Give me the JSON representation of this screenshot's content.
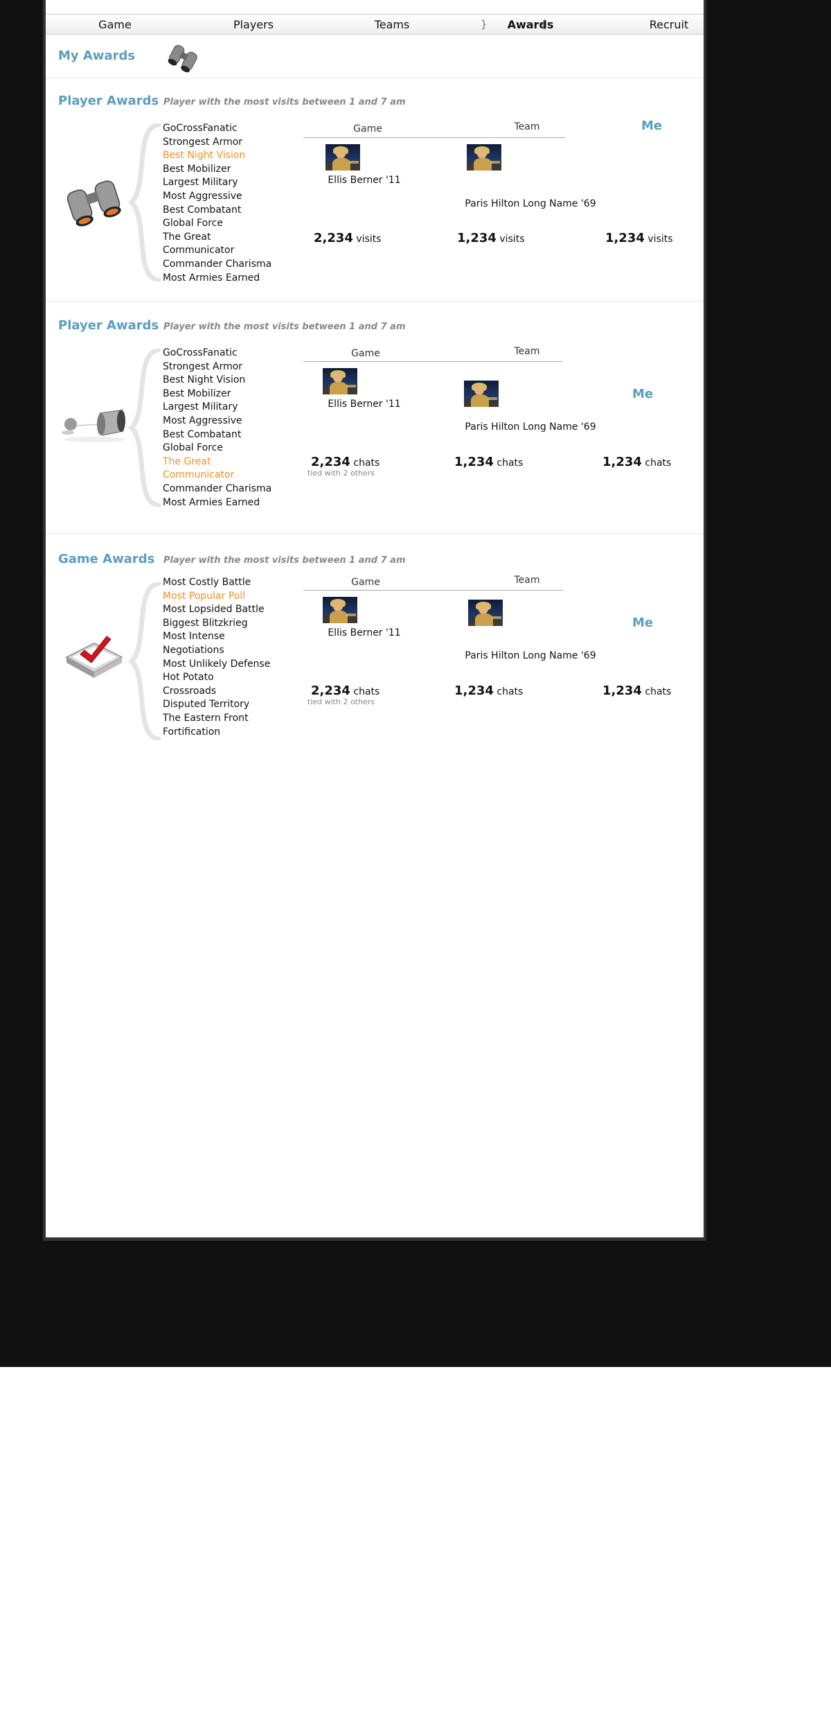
{
  "nav": {
    "items": [
      "Game",
      "Players",
      "Teams",
      "Awards",
      "Recruit"
    ],
    "active_index": 3
  },
  "my_awards": {
    "title": "My Awards",
    "icon": "binoculars-icon"
  },
  "sections": [
    {
      "title": "Player Awards",
      "description": "Player with the most visits between 1 and 7 am",
      "icon": "binoculars-icon",
      "awards": [
        "GoCrossFanatic",
        "Strongest Armor",
        "Best Night Vision",
        "Best Mobilizer",
        "Largest Military",
        "Most Aggressive",
        "Best Combatant",
        "Global Force",
        "The Great Communicator",
        "Commander Charisma",
        "Most Armies Earned"
      ],
      "selected": "Best Night Vision",
      "game_label": "Game",
      "team_label": "Team",
      "me_label": "Me",
      "game_name": "Ellis Berner '11",
      "team_name": "Paris Hilton Long Name '69",
      "game_value": "2,234",
      "team_value": "1,234",
      "me_value": "1,234",
      "unit": "visits",
      "tie_note": ""
    },
    {
      "title": "Player Awards",
      "description": "Player with the most visits between 1 and 7 am",
      "icon": "tin-can-phone-icon",
      "awards": [
        "GoCrossFanatic",
        "Strongest Armor",
        "Best Night Vision",
        "Best Mobilizer",
        "Largest Military",
        "Most Aggressive",
        "Best Combatant",
        "Global Force",
        "The Great Communicator",
        "Commander Charisma",
        "Most Armies Earned"
      ],
      "selected": "The Great Communicator",
      "game_label": "Game",
      "team_label": "Team",
      "me_label": "Me",
      "game_name": "Ellis Berner '11",
      "team_name": "Paris Hilton Long Name '69",
      "game_value": "2,234",
      "team_value": "1,234",
      "me_value": "1,234",
      "unit": "chats",
      "tie_note": "tied with 2 others"
    },
    {
      "title": "Game Awards",
      "description": "Player with the most visits between 1 and 7 am",
      "icon": "ballot-checkmark-icon",
      "awards": [
        "Most Costly Battle",
        "Most Popular Poll",
        "Most Lopsided Battle",
        "Biggest Blitzkrieg",
        "Most Intense Negotiations",
        "Most Unlikely Defense",
        "Hot Potato",
        "Crossroads",
        "Disputed Territory",
        "The Eastern Front",
        "Fortification"
      ],
      "selected": "Most Popular Poll",
      "game_label": "Game",
      "team_label": "Team",
      "me_label": "Me",
      "game_name": "Ellis Berner '11",
      "team_name": "Paris Hilton Long Name '69",
      "game_value": "2,234",
      "team_value": "1,234",
      "me_value": "1,234",
      "unit": "chats",
      "tie_note": "tied with 2 others"
    }
  ],
  "colors": {
    "accent": "#5a9dc0",
    "selected": "#f39020",
    "background": "#111111"
  }
}
